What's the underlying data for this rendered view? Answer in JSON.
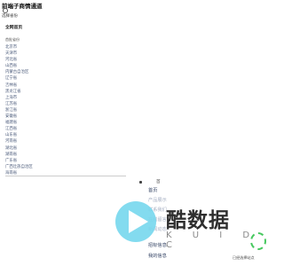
{
  "header": {
    "site_title": "前端子商情通道",
    "region_label": "选择省份"
  },
  "regions": {
    "all_label": "全网首页",
    "section_label": "首批省份",
    "provinces": [
      "北京市",
      "天津市",
      "河北省",
      "山西省",
      "内蒙古自治区",
      "辽宁省",
      "吉林省",
      "黑龙江省",
      "上海市",
      "江苏省",
      "浙江省",
      "安徽省",
      "福建省",
      "江西省",
      "山东省",
      "河南省",
      "湖北省",
      "湖南省",
      "广东省",
      "广西壮族自治区",
      "海南省"
    ]
  },
  "side": {
    "label": "首"
  },
  "menu": {
    "items": [
      {
        "label": "首页",
        "faded": false
      },
      {
        "label": "产品展示",
        "faded": true
      },
      {
        "label": "联系我们",
        "faded": true
      },
      {
        "label": "在线留言",
        "faded": true
      },
      {
        "label": "新闻动态",
        "faded": true
      },
      {
        "label": "招标信息",
        "faded": false
      },
      {
        "label": "我的信息",
        "faded": false
      }
    ]
  },
  "watermark": {
    "title": "酷数据",
    "subtitle": "K U I D C"
  },
  "footer": {
    "corner_text": "已经选择站点"
  }
}
